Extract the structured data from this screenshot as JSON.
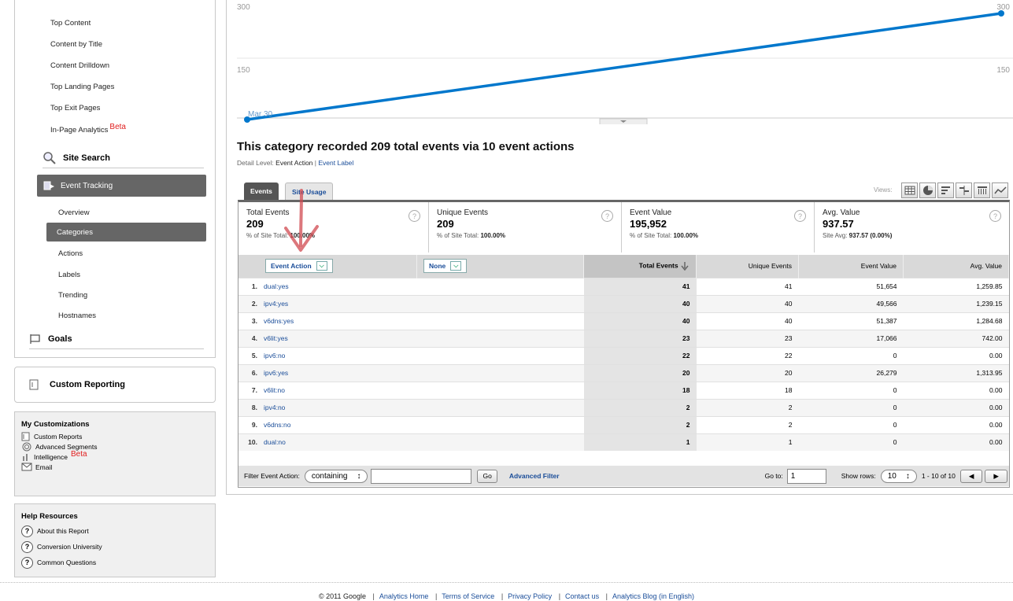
{
  "sidebar": {
    "content_items": [
      "Top Content",
      "Content by Title",
      "Content Drilldown",
      "Top Landing Pages",
      "Top Exit Pages"
    ],
    "in_page": "In-Page Analytics",
    "beta": "Beta",
    "site_search": "Site Search",
    "event_tracking": "Event Tracking",
    "event_items": [
      "Overview",
      "Categories",
      "Actions",
      "Labels",
      "Trending",
      "Hostnames"
    ],
    "goals": "Goals"
  },
  "custom_reporting": "Custom Reporting",
  "my_customizations": {
    "title": "My Customizations",
    "items": [
      "Custom Reports",
      "Advanced Segments",
      "Intelligence",
      "Email"
    ],
    "beta": "Beta"
  },
  "help_resources": {
    "title": "Help Resources",
    "items": [
      "About this Report",
      "Conversion University",
      "Common Questions"
    ]
  },
  "chart_data": {
    "type": "line",
    "x": [
      "Mar 30",
      ""
    ],
    "series": [
      {
        "values": [
          0,
          270
        ]
      }
    ],
    "ylim": [
      0,
      300
    ],
    "yticks_left": [
      "300",
      "150"
    ],
    "yticks_right": [
      "300",
      "150"
    ],
    "annotation": "Mar 30",
    "color": "#0077cc"
  },
  "main": {
    "title": "This category recorded 209 total events via 10 event actions",
    "detail_prefix": "Detail Level:",
    "detail_current": "Event Action",
    "detail_sep": "|",
    "detail_link": "Event Label",
    "tabs": [
      "Events",
      "Site Usage"
    ],
    "views_label": "Views:"
  },
  "summary": [
    {
      "label": "Total Events",
      "value": "209",
      "sub_prefix": "% of Site Total:",
      "sub_value": "100.00%"
    },
    {
      "label": "Unique Events",
      "value": "209",
      "sub_prefix": "% of Site Total:",
      "sub_value": "100.00%"
    },
    {
      "label": "Event Value",
      "value": "195,952",
      "sub_prefix": "% of Site Total:",
      "sub_value": "100.00%"
    },
    {
      "label": "Avg. Value",
      "value": "937.57",
      "sub_prefix": "Site Avg:",
      "sub_value": "937.57 (0.00%)"
    }
  ],
  "table": {
    "dim1": "Event Action",
    "dim2": "None",
    "columns": [
      "Total Events",
      "Unique Events",
      "Event Value",
      "Avg. Value"
    ],
    "rows": [
      {
        "n": "1.",
        "action": "dual:yes",
        "total": "41",
        "unique": "41",
        "value": "51,654",
        "avg": "1,259.85"
      },
      {
        "n": "2.",
        "action": "ipv4:yes",
        "total": "40",
        "unique": "40",
        "value": "49,566",
        "avg": "1,239.15"
      },
      {
        "n": "3.",
        "action": "v6dns:yes",
        "total": "40",
        "unique": "40",
        "value": "51,387",
        "avg": "1,284.68"
      },
      {
        "n": "4.",
        "action": "v6lit:yes",
        "total": "23",
        "unique": "23",
        "value": "17,066",
        "avg": "742.00"
      },
      {
        "n": "5.",
        "action": "ipv6:no",
        "total": "22",
        "unique": "22",
        "value": "0",
        "avg": "0.00"
      },
      {
        "n": "6.",
        "action": "ipv6:yes",
        "total": "20",
        "unique": "20",
        "value": "26,279",
        "avg": "1,313.95"
      },
      {
        "n": "7.",
        "action": "v6lit:no",
        "total": "18",
        "unique": "18",
        "value": "0",
        "avg": "0.00"
      },
      {
        "n": "8.",
        "action": "ipv4:no",
        "total": "2",
        "unique": "2",
        "value": "0",
        "avg": "0.00"
      },
      {
        "n": "9.",
        "action": "v6dns:no",
        "total": "2",
        "unique": "2",
        "value": "0",
        "avg": "0.00"
      },
      {
        "n": "10.",
        "action": "dual:no",
        "total": "1",
        "unique": "1",
        "value": "0",
        "avg": "0.00"
      }
    ]
  },
  "filter": {
    "label": "Filter Event Action:",
    "match": "containing",
    "go": "Go",
    "advanced": "Advanced Filter",
    "goto_label": "Go to:",
    "goto_value": "1",
    "show_rows_label": "Show rows:",
    "show_rows_value": "10",
    "range": "1 - 10 of 10"
  },
  "footer": {
    "copyright": "© 2011 Google",
    "links": [
      "Analytics Home",
      "Terms of Service",
      "Privacy Policy",
      "Contact us",
      "Analytics Blog (in English)"
    ]
  }
}
